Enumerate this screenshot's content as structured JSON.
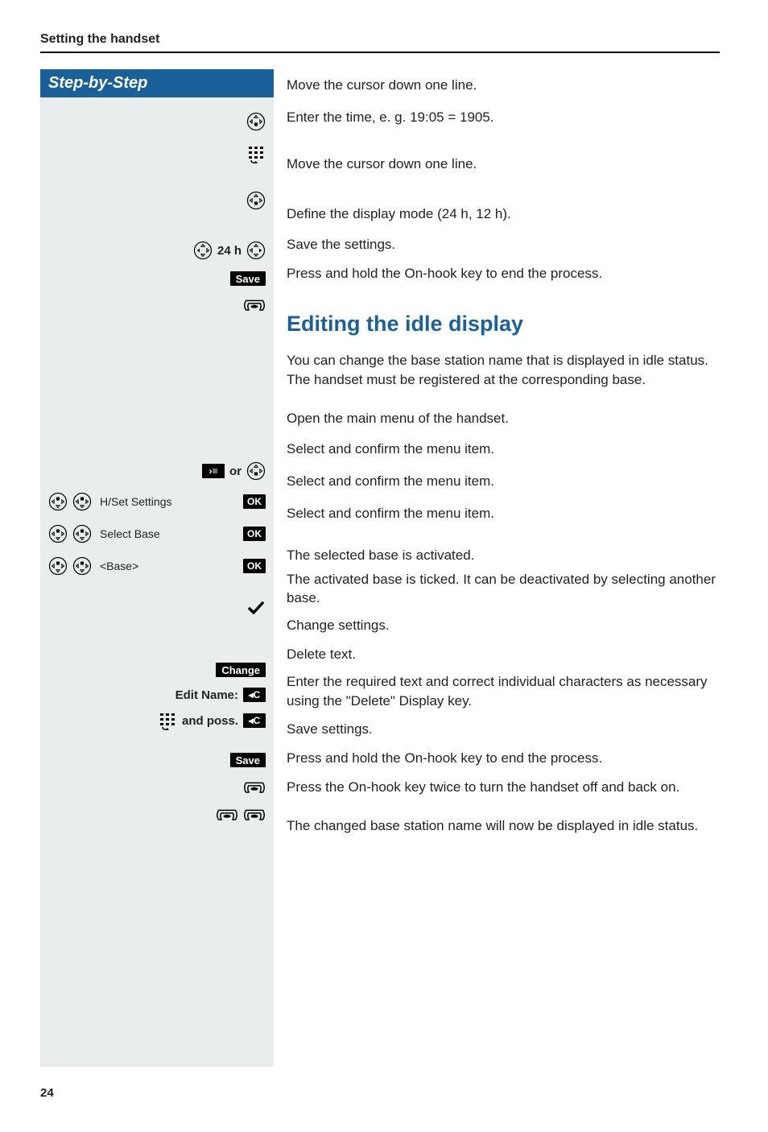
{
  "pageHeader": "Setting the handset",
  "pageNumber": "24",
  "stepByStepTitle": "Step-by-Step",
  "softkeys": {
    "save": "Save",
    "ok": "OK",
    "change": "Change",
    "deleteC": "◂C",
    "menu": " ›≡ "
  },
  "labels": {
    "timeMode": "24 h",
    "or": "or",
    "hsetSettings": "H/Set Settings",
    "selectBase": "Select Base",
    "basePlaceholder": "<Base>",
    "editName": "Edit Name:",
    "andPoss": "and poss."
  },
  "section1": [
    "Move the cursor down one line.",
    "Enter the time, e. g. 19:05 = 1905.",
    "Move the cursor down one line.",
    "Define the display mode (24 h, 12 h).",
    "Save the settings.",
    "Press and hold the On-hook key to end the process."
  ],
  "section2": {
    "title": "Editing the idle display",
    "intro": "You can change the base station name that is displayed in idle status. The handset must be registered at the corresponding base.",
    "steps": [
      "Open the main menu of the handset.",
      "Select and confirm the menu item.",
      "Select and confirm the menu item.",
      "Select and confirm the menu item.",
      "The selected base is activated.",
      "The activated base is ticked. It can be deactivated by selecting another base.",
      "Change settings.",
      "Delete text.",
      "Enter the required text and correct individual characters as necessary using the \"Delete\" Display key.",
      "Save settings.",
      "Press and hold the On-hook key to end the process.",
      "Press the On-hook key twice to turn the handset off and back on.",
      "The changed base station name will now be displayed in idle status."
    ]
  }
}
